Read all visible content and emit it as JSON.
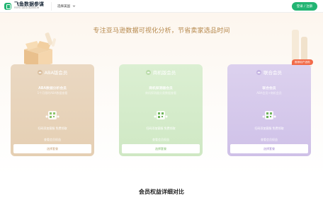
{
  "header": {
    "logo_title": "飞鱼数据参谋",
    "logo_sub": "FEIYU DATA ADVISOR",
    "site_select": "选择美国",
    "login_button": "登录 / 注册"
  },
  "hero": {
    "headline": "专注亚马逊数据可视化分析，节省卖家选品时间"
  },
  "cards": [
    {
      "name": "ABA版会员",
      "sub_title": "ABA数据分析会员",
      "desc": "1个月限时ABA数据查看",
      "qr_note": "扫码添加客服 免费领取",
      "benefit": "查看会员权益",
      "choose": "选择套餐"
    },
    {
      "name": "商机版会员",
      "sub_title": "商机探测器会员",
      "desc": "商机探测器分类数据查看",
      "qr_note": "扫码添加客服 免费领取",
      "benefit": "查看会员权益",
      "choose": "选择套餐"
    },
    {
      "name": "联合会员",
      "sub_title": "联合会员",
      "desc": "ABA会员+商机会员",
      "qr_note": "扫码添加客服 免费领取",
      "benefit": "查看会员权益",
      "choose": "选择套餐"
    }
  ],
  "badge": "推荐用户选购",
  "compare_title": "会员权益详细对比",
  "colors": {
    "brand_green": "#22b573",
    "headline": "#b5874a",
    "badge": "#f26b4a"
  }
}
